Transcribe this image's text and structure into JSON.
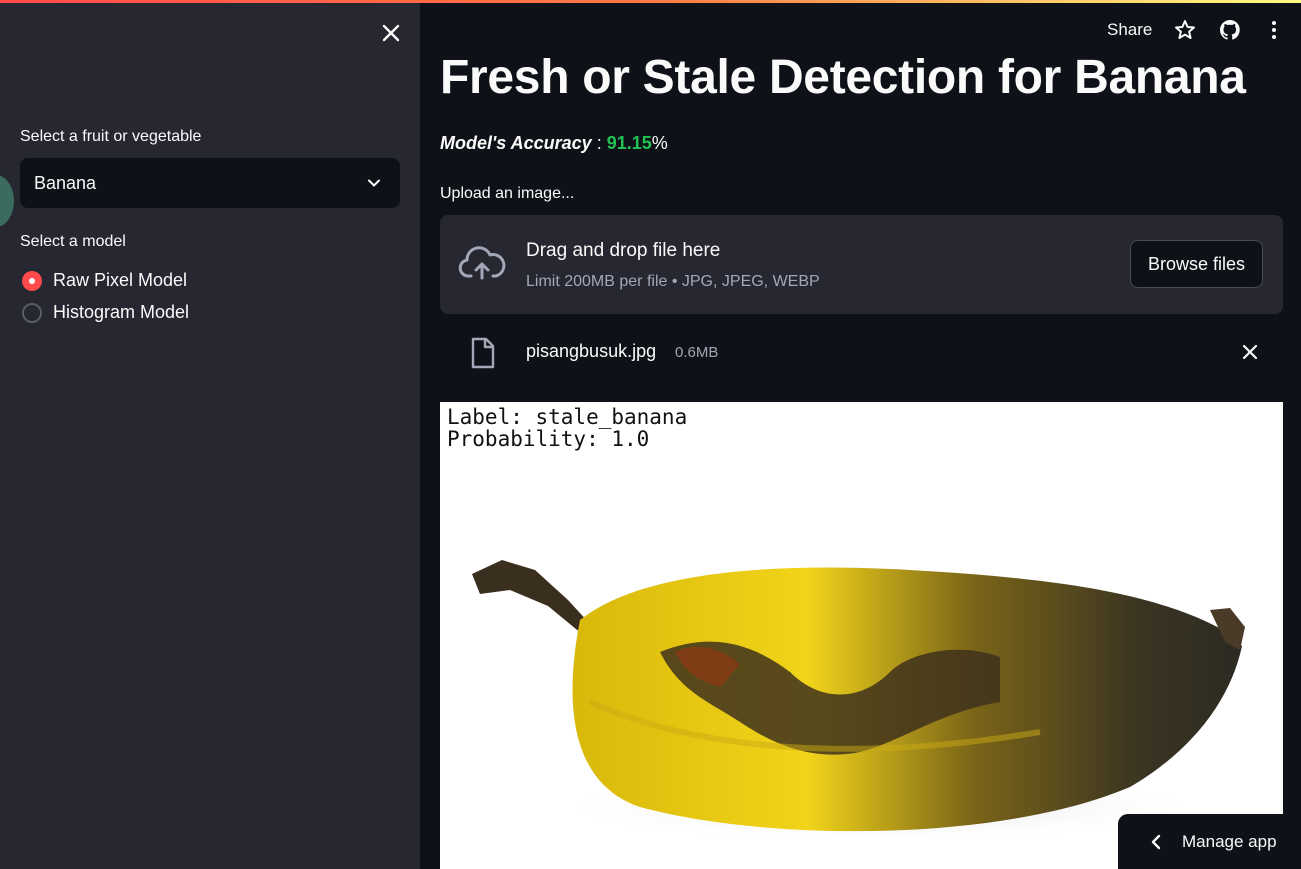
{
  "sidebar": {
    "fruit_label": "Select a fruit or vegetable",
    "fruit_selected": "Banana",
    "model_label": "Select a model",
    "models": [
      {
        "label": "Raw Pixel Model",
        "selected": true
      },
      {
        "label": "Histogram Model",
        "selected": false
      }
    ]
  },
  "header": {
    "share_label": "Share",
    "icons": [
      "star-icon",
      "github-icon",
      "more-vertical-icon"
    ]
  },
  "main": {
    "title": "Fresh or Stale Detection for Banana",
    "accuracy_label": "Model's Accuracy",
    "accuracy_sep": " : ",
    "accuracy_value": "91.15",
    "accuracy_unit": "%",
    "upload_label": "Upload an image...",
    "dropzone": {
      "title": "Drag and drop file here",
      "subtitle": "Limit 200MB per file • JPG, JPEG, WEBP",
      "browse_label": "Browse files"
    },
    "file": {
      "name": "pisangbusuk.jpg",
      "size": "0.6MB"
    },
    "result": {
      "label_line": "Label: stale_banana",
      "prob_line": "Probability: 1.0"
    }
  },
  "manage_app_label": "Manage app",
  "colors": {
    "accent": "#ff4b4b",
    "accuracy": "#21c354",
    "background": "#0e1117",
    "sidebar": "#262730"
  }
}
